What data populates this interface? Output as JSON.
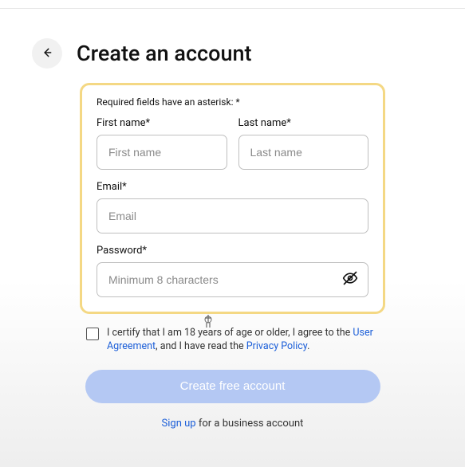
{
  "header": {
    "title": "Create an account"
  },
  "form": {
    "required_note": "Required fields have an asterisk: *",
    "first_name": {
      "label": "First name*",
      "placeholder": "First name",
      "value": ""
    },
    "last_name": {
      "label": "Last name*",
      "placeholder": "Last name",
      "value": ""
    },
    "email": {
      "label": "Email*",
      "placeholder": "Email",
      "value": ""
    },
    "password": {
      "label": "Password*",
      "placeholder": "Minimum 8 characters",
      "value": ""
    }
  },
  "consent": {
    "text_before": "I certify that I am 18 years of age or older, I agree to the ",
    "user_agreement": "User Agreement",
    "text_middle": ", and I have read the ",
    "privacy_policy": "Privacy Policy",
    "text_end": "."
  },
  "submit": {
    "label": "Create free account"
  },
  "business": {
    "link": "Sign up",
    "rest": " for a business account"
  }
}
